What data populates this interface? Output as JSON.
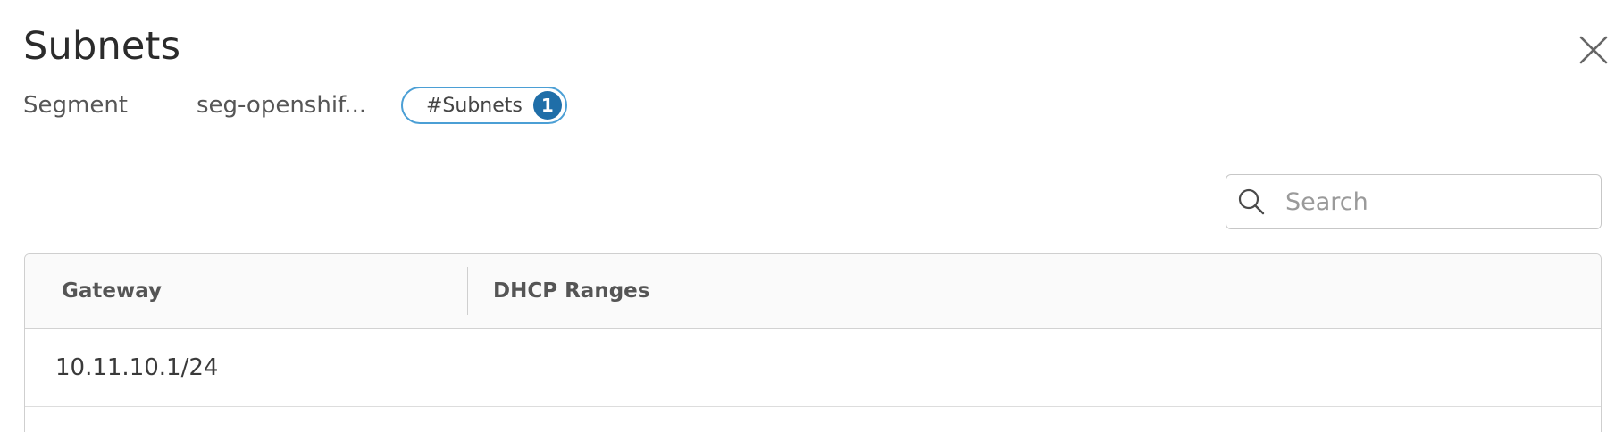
{
  "dialog": {
    "title": "Subnets",
    "close_icon": "close-icon"
  },
  "subheader": {
    "label": "Segment",
    "value": "seg-openshif...",
    "pill": {
      "label": "#Subnets",
      "count": "1"
    }
  },
  "search": {
    "placeholder": "Search",
    "value": "",
    "icon": "search-icon"
  },
  "grid": {
    "columns": [
      "Gateway",
      "DHCP Ranges"
    ],
    "rows": [
      {
        "gateway": "10.11.10.1/24",
        "dhcp_ranges": ""
      }
    ]
  },
  "colors": {
    "accent": "#1f6ea8",
    "pill_border": "#4b9fd5"
  }
}
